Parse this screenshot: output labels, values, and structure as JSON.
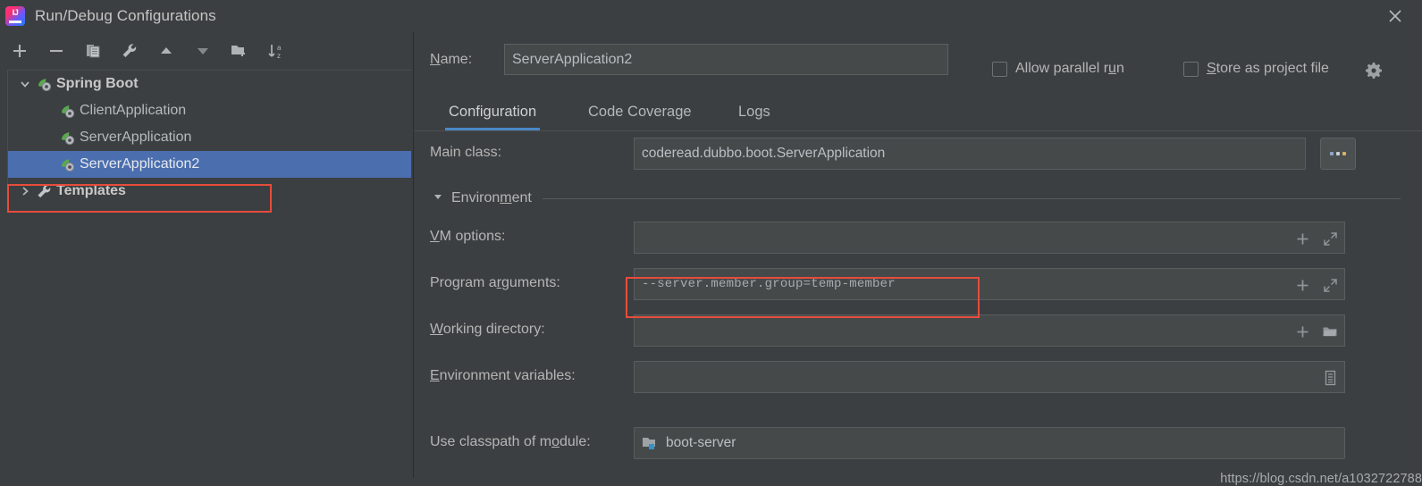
{
  "window": {
    "title": "Run/Debug Configurations",
    "logo_icon": "intellij-idea-logo",
    "close_icon": "close-icon"
  },
  "toolbar": {
    "buttons": [
      {
        "name": "add",
        "icon": "plus-icon",
        "tooltip": "Add New Configuration"
      },
      {
        "name": "remove",
        "icon": "minus-icon",
        "tooltip": "Remove Configuration"
      },
      {
        "name": "copy",
        "icon": "copy-icon",
        "tooltip": "Copy Configuration"
      },
      {
        "name": "edit-templates",
        "icon": "wrench-icon",
        "tooltip": "Edit Templates"
      },
      {
        "name": "move-up",
        "icon": "arrow-up-icon",
        "tooltip": "Move Up"
      },
      {
        "name": "move-down",
        "icon": "arrow-down-icon",
        "tooltip": "Move Down"
      },
      {
        "name": "new-folder",
        "icon": "new-folder-icon",
        "tooltip": "Create New Folder"
      },
      {
        "name": "sort",
        "icon": "sort-alphabetically-icon",
        "tooltip": "Sort Configurations"
      }
    ]
  },
  "tree": {
    "nodes": [
      {
        "label": "Spring Boot",
        "level": 0,
        "expanded": true,
        "icon": "spring-boot-icon",
        "selected": false
      },
      {
        "label": "ClientApplication",
        "level": 1,
        "icon": "spring-boot-icon",
        "selected": false
      },
      {
        "label": "ServerApplication",
        "level": 1,
        "icon": "spring-boot-icon",
        "selected": false
      },
      {
        "label": "ServerApplication2",
        "level": 1,
        "icon": "spring-boot-icon",
        "selected": true
      },
      {
        "label": "Templates",
        "level": 0,
        "expanded": false,
        "icon": "wrench-icon",
        "selected": false
      }
    ]
  },
  "header": {
    "name_label": "Name:",
    "name_value": "ServerApplication2",
    "name_placeholder": "",
    "allow_parallel_run_label": "Allow parallel run",
    "allow_parallel_run_checked": false,
    "store_as_project_file_label": "Store as project file",
    "store_as_project_file_checked": false,
    "gear_icon": "gear-icon"
  },
  "tabs": [
    {
      "label": "Configuration",
      "active": true
    },
    {
      "label": "Code Coverage",
      "active": false
    },
    {
      "label": "Logs",
      "active": false
    }
  ],
  "form": {
    "main_class": {
      "label": "Main class:",
      "value": "coderead.dubbo.boot.ServerApplication",
      "browse_label": "...",
      "browse_icon": "ellipsis-icon"
    },
    "environment_section": {
      "label": "Environment",
      "expanded": true,
      "triangle_icon": "triangle-down-icon"
    },
    "vm_options": {
      "label": "VM options:",
      "value": "",
      "actions": [
        "plus-icon",
        "expand-icon"
      ]
    },
    "program_arguments": {
      "label": "Program arguments:",
      "value": "--server.member.group=temp-member",
      "actions": [
        "plus-icon",
        "expand-icon"
      ],
      "highlighted": true,
      "highlight_color": "#e74c3c"
    },
    "working_directory": {
      "label": "Working directory:",
      "value": "",
      "actions": [
        "plus-icon",
        "folder-icon"
      ]
    },
    "environment_variables": {
      "label": "Environment variables:",
      "value": "",
      "actions": [
        "list-icon"
      ]
    },
    "use_classpath_of_module": {
      "label": "Use classpath of module:",
      "value": "boot-server",
      "icon": "module-icon",
      "dropdown_icon": "chevron-down-icon"
    }
  },
  "watermark": {
    "text": "https://blog.csdn.net/a1032722788"
  },
  "colors": {
    "background": "#3c3f41",
    "field_background": "#45494a",
    "selection_blue": "#4b6eaf",
    "tab_accent": "#4a88c7",
    "highlight_red": "#e74c3c",
    "text": "#b5b5b5",
    "spring_green": "#6aa84f"
  }
}
